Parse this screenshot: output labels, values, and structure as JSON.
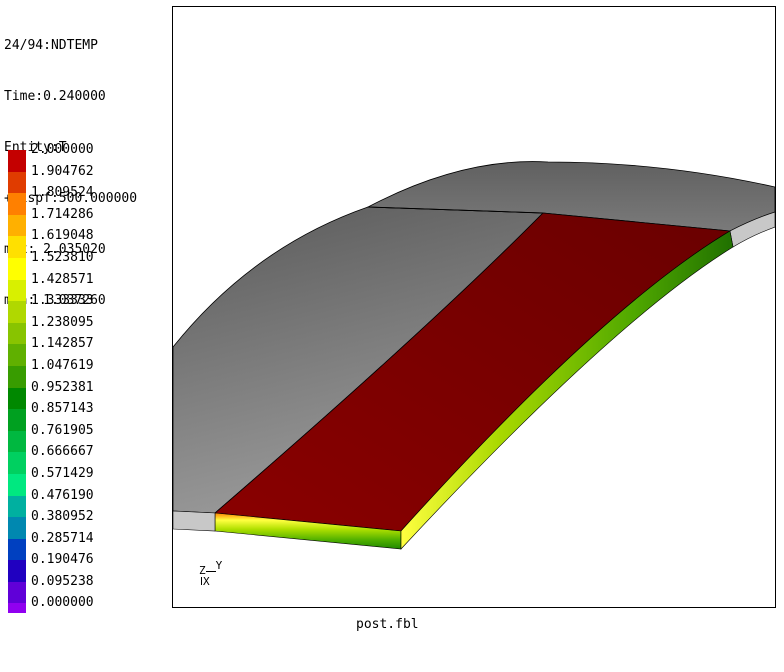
{
  "info": {
    "step_line": "24/94:NDTEMP",
    "time_line": "Time:0.240000",
    "entity_line": "Entity:T",
    "dispf_line": "+Dispf:500.000000",
    "max_line": "max: 2.035020",
    "min_line": "min: 1.037260"
  },
  "legend": {
    "labels": [
      "2.000000",
      "1.904762",
      "1.809524",
      "1.714286",
      "1.619048",
      "1.523810",
      "1.428571",
      "1.333333",
      "1.238095",
      "1.142857",
      "1.047619",
      "0.952381",
      "0.857143",
      "0.761905",
      "0.666667",
      "0.571429",
      "0.476190",
      "0.380952",
      "0.285714",
      "0.190476",
      "0.095238",
      "0.000000"
    ],
    "colors": [
      "#c40000",
      "#e03c00",
      "#ff8000",
      "#ffb000",
      "#ffe000",
      "#ffff00",
      "#d8f000",
      "#b0d800",
      "#88c400",
      "#60b000",
      "#389c00",
      "#008800",
      "#00a020",
      "#00b840",
      "#00d060",
      "#00e880",
      "#00b0a0",
      "#0088b0",
      "#0040c0",
      "#2000c0",
      "#6000d8",
      "#9000f0"
    ]
  },
  "viewport": {
    "triad": {
      "z_label": "Z",
      "y_label": "Y",
      "x_label": "X"
    }
  },
  "footer": {
    "filename": "post.fbl"
  },
  "colors": {
    "hot_region": "#800000",
    "shell_grey": "#8a8a8a",
    "edge_green": "#40b000"
  }
}
